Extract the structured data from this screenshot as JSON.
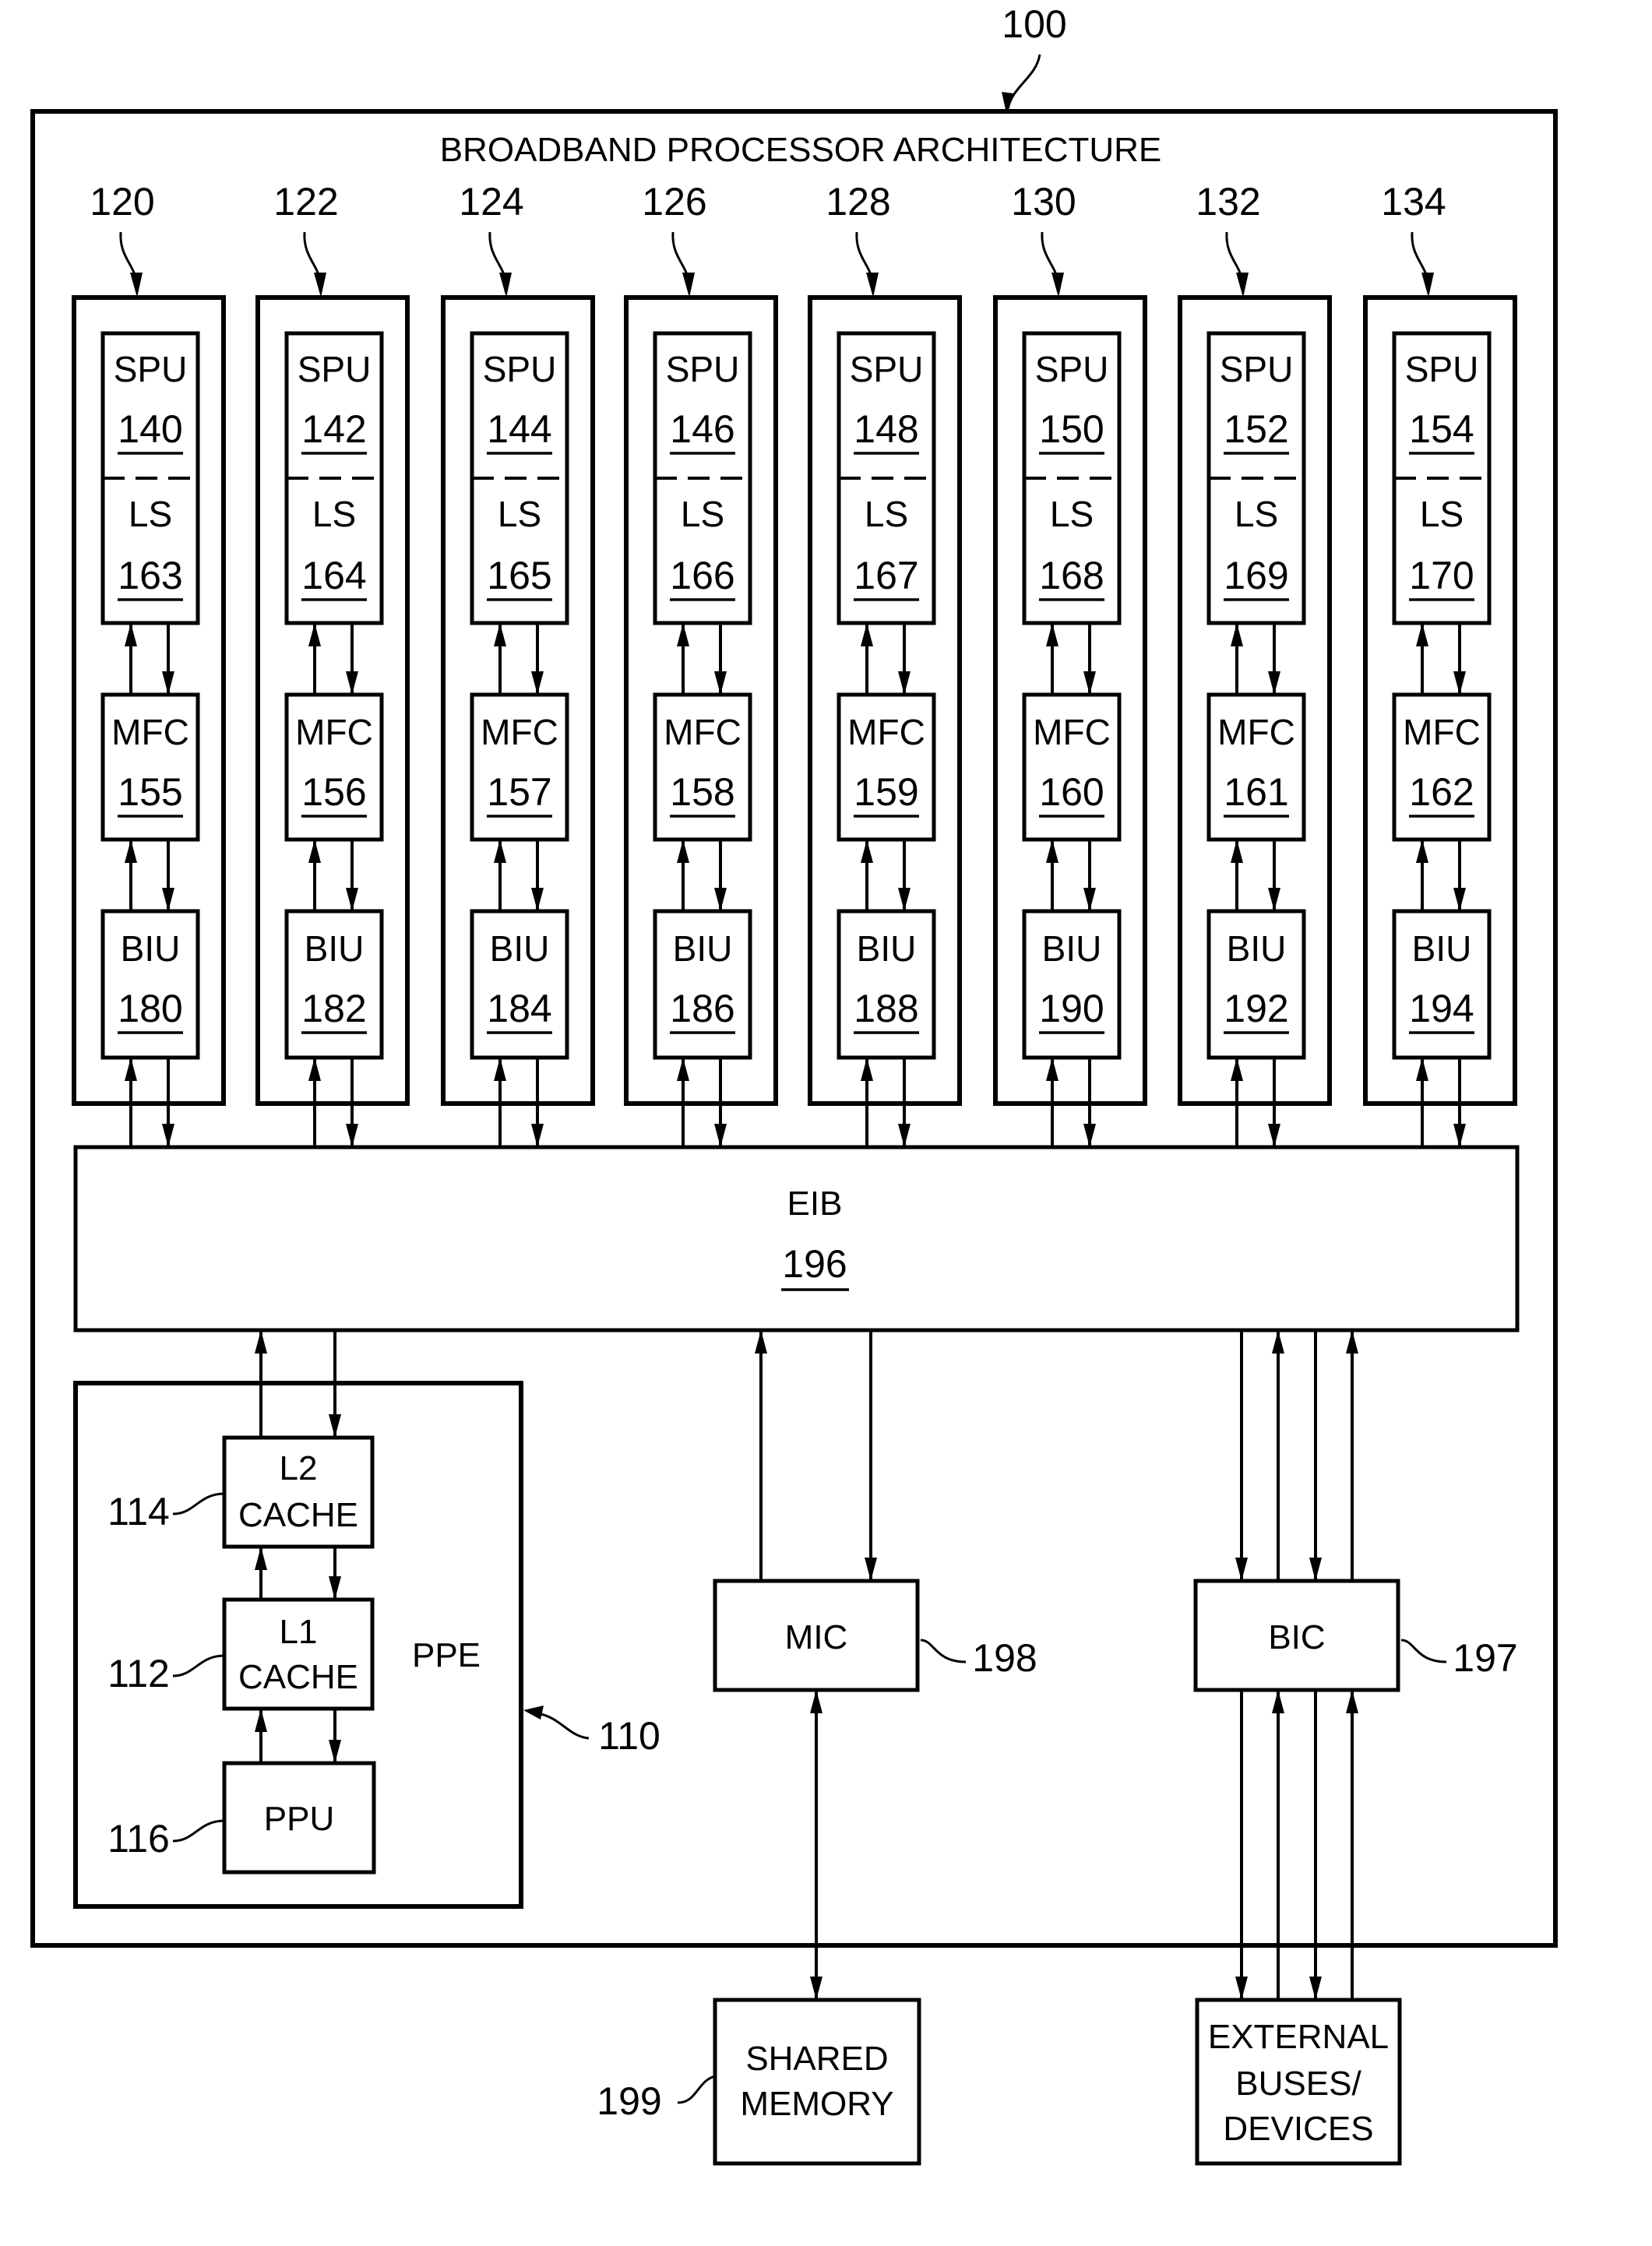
{
  "figure": {
    "ref": "100",
    "title": "BROADBAND PROCESSOR ARCHITECTURE"
  },
  "spe_columns": [
    {
      "ref": "120",
      "spu": "140",
      "ls": "163",
      "mfc": "155",
      "biu": "180"
    },
    {
      "ref": "122",
      "spu": "142",
      "ls": "164",
      "mfc": "156",
      "biu": "182"
    },
    {
      "ref": "124",
      "spu": "144",
      "ls": "165",
      "mfc": "157",
      "biu": "184"
    },
    {
      "ref": "126",
      "spu": "146",
      "ls": "166",
      "mfc": "158",
      "biu": "186"
    },
    {
      "ref": "128",
      "spu": "148",
      "ls": "167",
      "mfc": "159",
      "biu": "188"
    },
    {
      "ref": "130",
      "spu": "150",
      "ls": "168",
      "mfc": "160",
      "biu": "190"
    },
    {
      "ref": "132",
      "spu": "152",
      "ls": "169",
      "mfc": "161",
      "biu": "192"
    },
    {
      "ref": "134",
      "spu": "154",
      "ls": "170",
      "mfc": "162",
      "biu": "194"
    }
  ],
  "labels": {
    "spu": "SPU",
    "ls": "LS",
    "mfc": "MFC",
    "biu": "BIU"
  },
  "eib": {
    "label": "EIB",
    "ref": "196"
  },
  "ppe": {
    "label": "PPE",
    "ref": "110",
    "l2": {
      "line1": "L2",
      "line2": "CACHE",
      "ref": "114"
    },
    "l1": {
      "line1": "L1",
      "line2": "CACHE",
      "ref": "112"
    },
    "ppu": {
      "label": "PPU",
      "ref": "116"
    }
  },
  "mic": {
    "label": "MIC",
    "ref": "198"
  },
  "bic": {
    "label": "BIC",
    "ref": "197"
  },
  "shared_memory": {
    "line1": "SHARED",
    "line2": "MEMORY",
    "ref": "199"
  },
  "external": {
    "line1": "EXTERNAL",
    "line2": "BUSES/",
    "line3": "DEVICES"
  }
}
